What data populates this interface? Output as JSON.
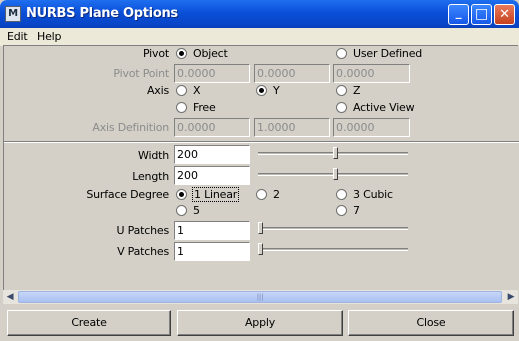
{
  "window": {
    "title": "NURBS Plane Options",
    "icon_letter": "M"
  },
  "title_buttons": {
    "minimize": "_",
    "maximize": "□",
    "close": "✕"
  },
  "menu": {
    "edit": "Edit",
    "help": "Help"
  },
  "pivot": {
    "label": "Pivot",
    "object": "Object",
    "user_defined": "User Defined",
    "selected": "Object"
  },
  "pivot_point": {
    "label": "Pivot Point",
    "x": "0.0000",
    "y": "0.0000",
    "z": "0.0000"
  },
  "axis": {
    "label": "Axis",
    "x": "X",
    "y": "Y",
    "z": "Z",
    "free": "Free",
    "active_view": "Active View",
    "selected": "Y"
  },
  "axis_definition": {
    "label": "Axis Definition",
    "x": "0.0000",
    "y": "1.0000",
    "z": "0.0000"
  },
  "width": {
    "label": "Width",
    "value": "200",
    "slider_fraction": 0.52
  },
  "length": {
    "label": "Length",
    "value": "200",
    "slider_fraction": 0.52
  },
  "surface_degree": {
    "label": "Surface Degree",
    "linear": "1 Linear",
    "two": "2",
    "cubic": "3 Cubic",
    "five": "5",
    "seven": "7",
    "selected": "1 Linear"
  },
  "u_patches": {
    "label": "U Patches",
    "value": "1",
    "slider_fraction": 0.0
  },
  "v_patches": {
    "label": "V Patches",
    "value": "1",
    "slider_fraction": 0.0
  },
  "scroll": {
    "left": "◀",
    "right": "▶",
    "grip": "|||"
  },
  "buttons": {
    "create": "Create",
    "apply": "Apply",
    "close": "Close"
  }
}
